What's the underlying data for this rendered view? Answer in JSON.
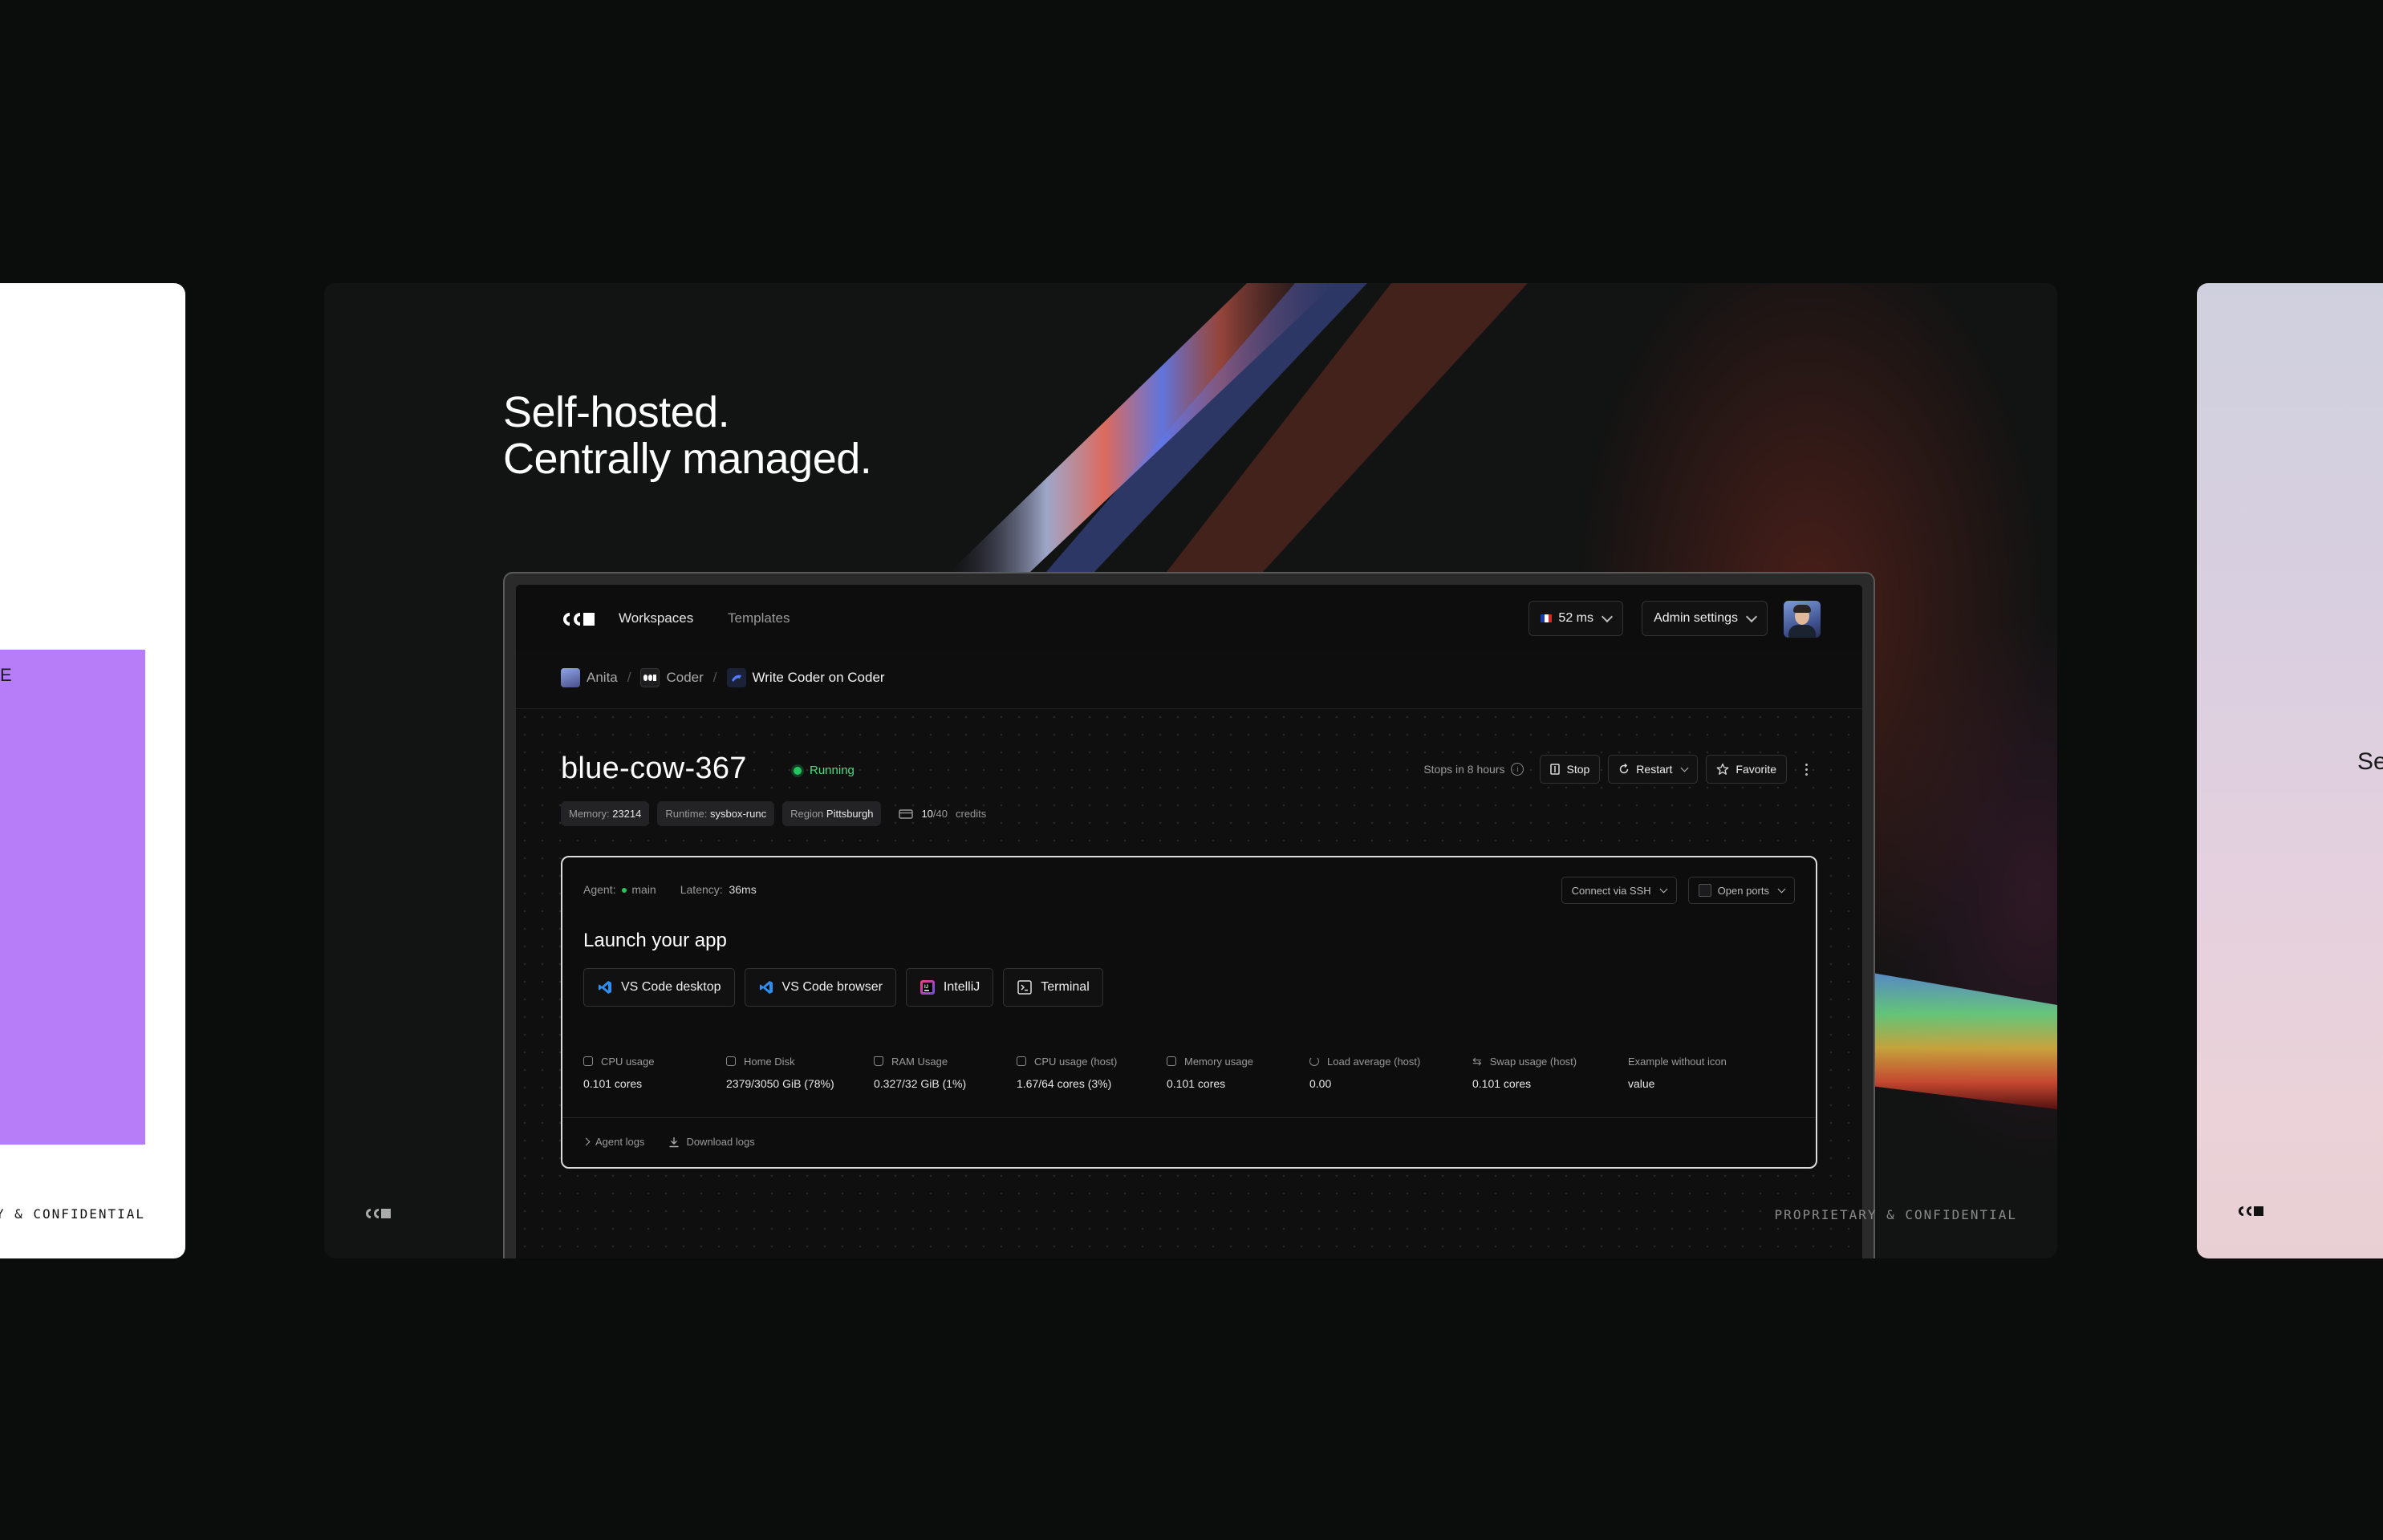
{
  "left_slide": {
    "confidential": "PROPRIETARY & CONFIDENTIAL",
    "glyph": "E"
  },
  "main_slide": {
    "headline_line1": "Self-hosted.",
    "headline_line2": "Centrally managed.",
    "footer_confidential": "PROPRIETARY & CONFIDENTIAL"
  },
  "right_slide": {
    "partial_text": "Se"
  },
  "app": {
    "nav": {
      "workspaces": "Workspaces",
      "templates": "Templates",
      "latency": "52 ms",
      "admin_settings": "Admin settings"
    },
    "breadcrumb": {
      "user": "Anita",
      "org": "Coder",
      "workspace": "Write Coder on Coder"
    },
    "workspace": {
      "name": "blue-cow-367",
      "status": "Running",
      "stops_in": "Stops in 8 hours",
      "stop": "Stop",
      "restart": "Restart",
      "favorite": "Favorite",
      "tags": [
        {
          "label": "Memory:",
          "value": "23214"
        },
        {
          "label": "Runtime:",
          "value": "sysbox-runc"
        },
        {
          "label": "Region",
          "value": "Pittsburgh"
        }
      ],
      "credits_used": "10",
      "credits_total": "/40",
      "credits_label": "credits"
    },
    "agent": {
      "agent_label": "Agent:",
      "agent_name": "main",
      "latency_label": "Latency:",
      "latency_value": "36ms",
      "connect_ssh": "Connect via SSH",
      "open_ports": "Open ports",
      "launch_title": "Launch your app",
      "apps": [
        "VS Code desktop",
        "VS Code browser",
        "IntelliJ",
        "Terminal"
      ],
      "stats": [
        {
          "label": "CPU usage",
          "value": "0.101 cores"
        },
        {
          "label": "Home Disk",
          "value": "2379/3050 GiB (78%)"
        },
        {
          "label": "RAM Usage",
          "value": "0.327/32 GiB (1%)"
        },
        {
          "label": "CPU usage (host)",
          "value": "1.67/64 cores (3%)"
        },
        {
          "label": "Memory usage",
          "value": "0.101 cores"
        },
        {
          "label": "Load average (host)",
          "value": "0.00"
        },
        {
          "label": "Swap usage (host)",
          "value": "0.101 cores"
        },
        {
          "label": "Example without icon",
          "value": "value"
        }
      ],
      "agent_logs": "Agent logs",
      "download_logs": "Download logs"
    }
  }
}
